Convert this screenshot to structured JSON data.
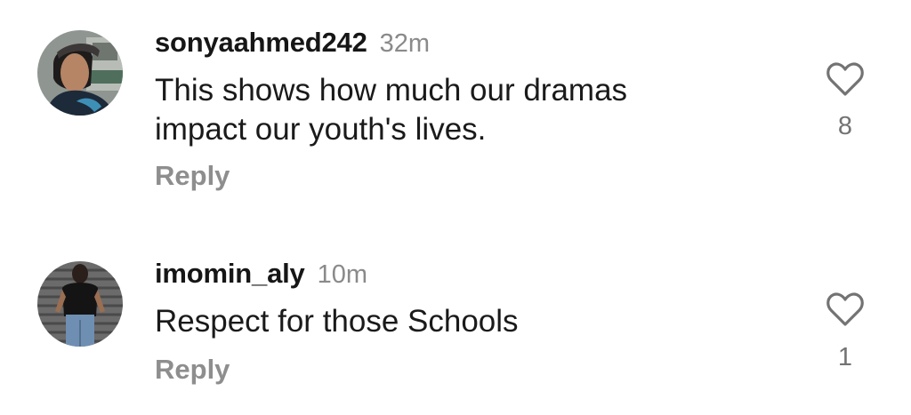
{
  "comments": [
    {
      "username": "sonyaahmed242",
      "timestamp": "32m",
      "text_lines": [
        "This shows how much our dramas",
        "impact our youth's lives."
      ],
      "reply_label": "Reply",
      "likes": "8",
      "avatar_icon": "profile-photo-woman"
    },
    {
      "username": "imomin_aly",
      "timestamp": "10m",
      "text_lines": [
        "Respect for those Schools"
      ],
      "reply_label": "Reply",
      "likes": "1",
      "avatar_icon": "profile-photo-man"
    }
  ],
  "icons": {
    "like": "heart-outline-icon"
  },
  "colors": {
    "username": "#161616",
    "timestamp": "#8a8a8a",
    "reply": "#8e8e8e",
    "like_count": "#737373"
  }
}
